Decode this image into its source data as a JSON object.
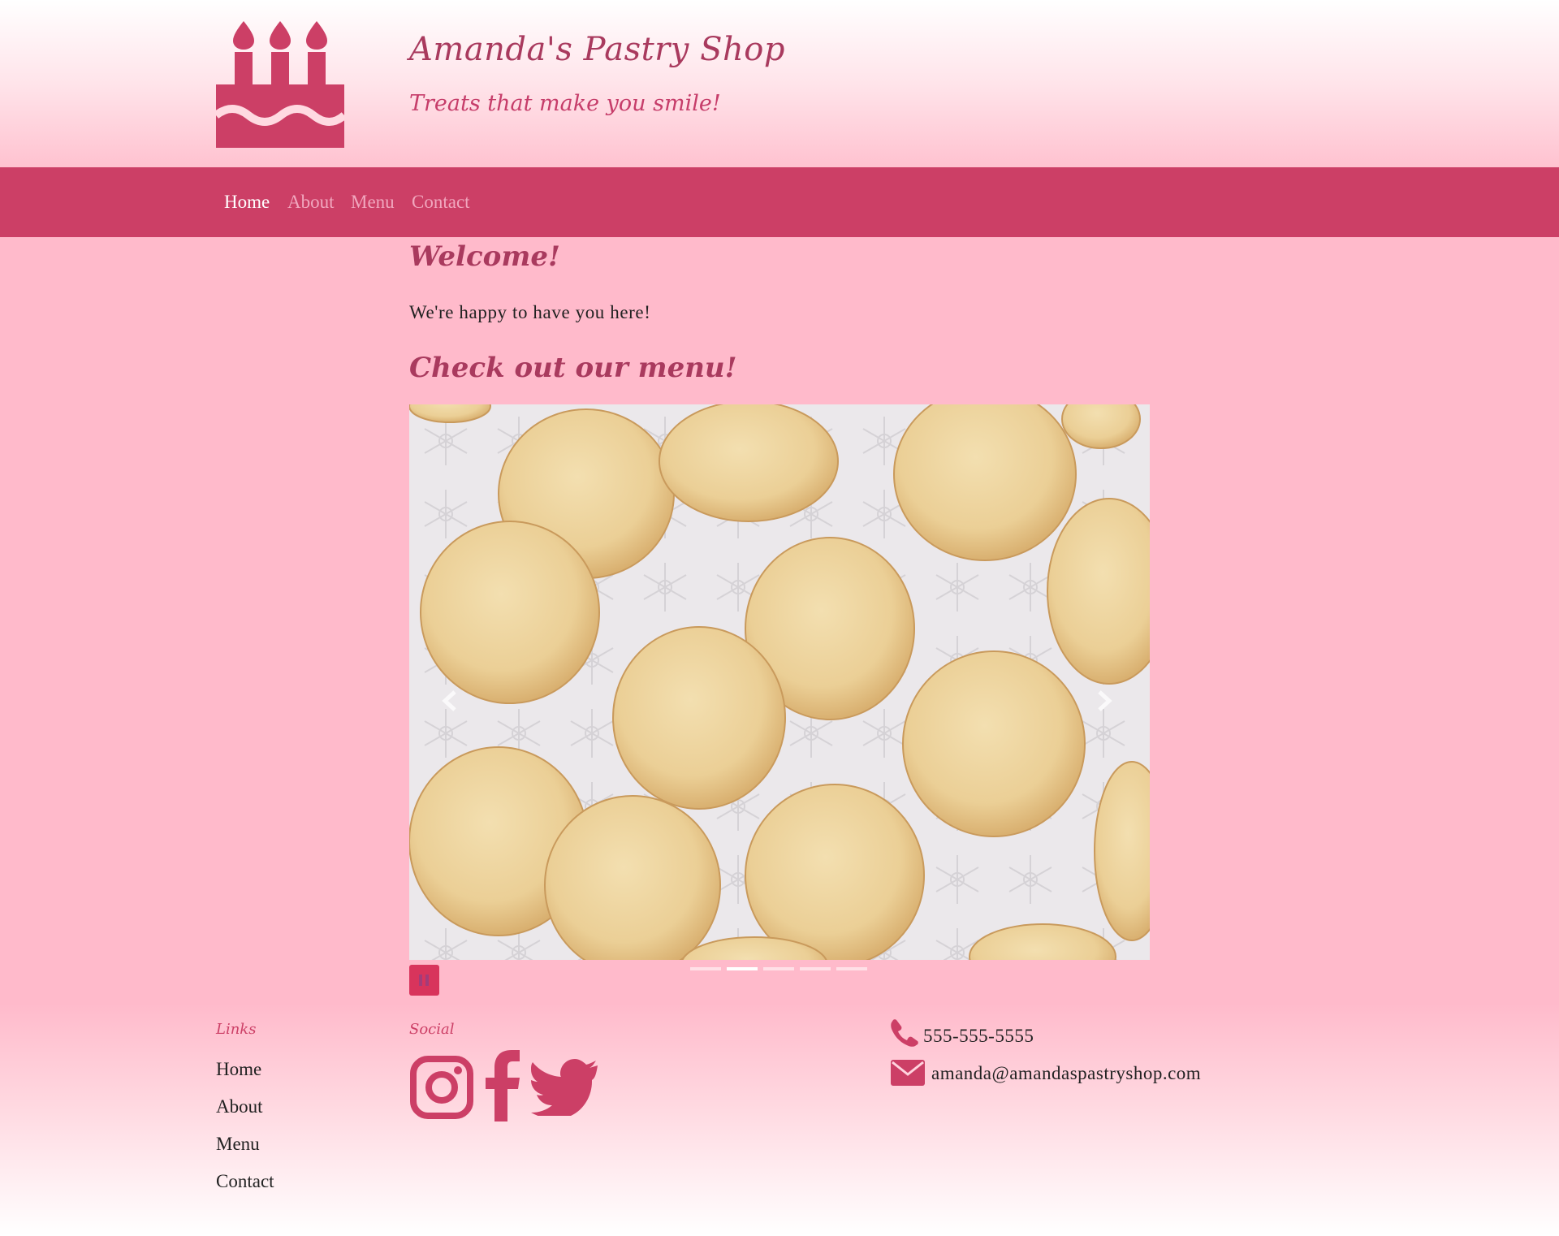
{
  "header": {
    "title": "Amanda's Pastry Shop",
    "tagline": "Treats that make you smile!",
    "logo_icon": "birthday-cake-icon"
  },
  "nav": {
    "items": [
      {
        "label": "Home",
        "active": true
      },
      {
        "label": "About",
        "active": false
      },
      {
        "label": "Menu",
        "active": false
      },
      {
        "label": "Contact",
        "active": false
      }
    ]
  },
  "main": {
    "welcome_heading": "Welcome!",
    "welcome_text": "We're happy to have you here!",
    "menu_heading": "Check out our menu!"
  },
  "carousel": {
    "slide_count": 5,
    "active_slide": 2,
    "prev_icon": "chevron-left-icon",
    "next_icon": "chevron-right-icon",
    "pause_icon": "pause-icon"
  },
  "footer": {
    "links_heading": "Links",
    "links": [
      "Home",
      "About",
      "Menu",
      "Contact"
    ],
    "social_heading": "Social",
    "social_icons": [
      "instagram-icon",
      "facebook-icon",
      "twitter-icon"
    ],
    "phone": "555-555-5555",
    "email": "amanda@amandaspastryshop.com"
  },
  "colors": {
    "accent": "#cc3f66",
    "heading": "#a93a5e",
    "background": "#ffbacb"
  }
}
